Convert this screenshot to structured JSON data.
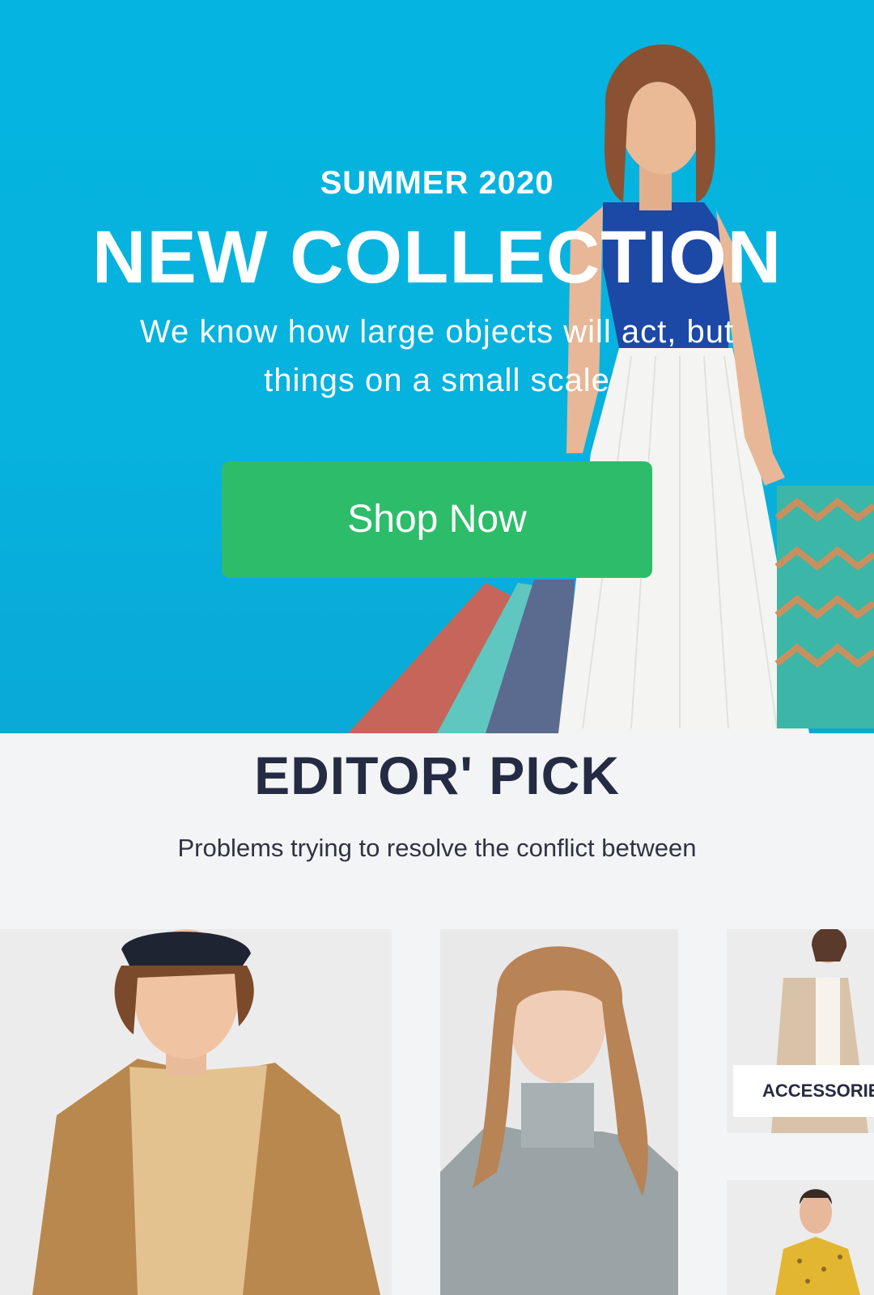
{
  "hero": {
    "eyebrow": "SUMMER 2020",
    "title": "NEW COLLECTION",
    "subtitle": "We know how large objects will act, but things on a small scale",
    "cta_label": "Shop Now",
    "background_color": "#05b4e0",
    "cta_color": "#2dbd6a"
  },
  "editors_pick": {
    "title": "EDITOR' PICK",
    "subtitle": "Problems trying to resolve the conflict between",
    "categories": [
      {
        "label": ""
      },
      {
        "label": ""
      },
      {
        "label": "ACCESSORIES"
      },
      {
        "label": ""
      }
    ]
  },
  "colors": {
    "heading": "#252b42",
    "page_background": "#f3f4f6"
  }
}
